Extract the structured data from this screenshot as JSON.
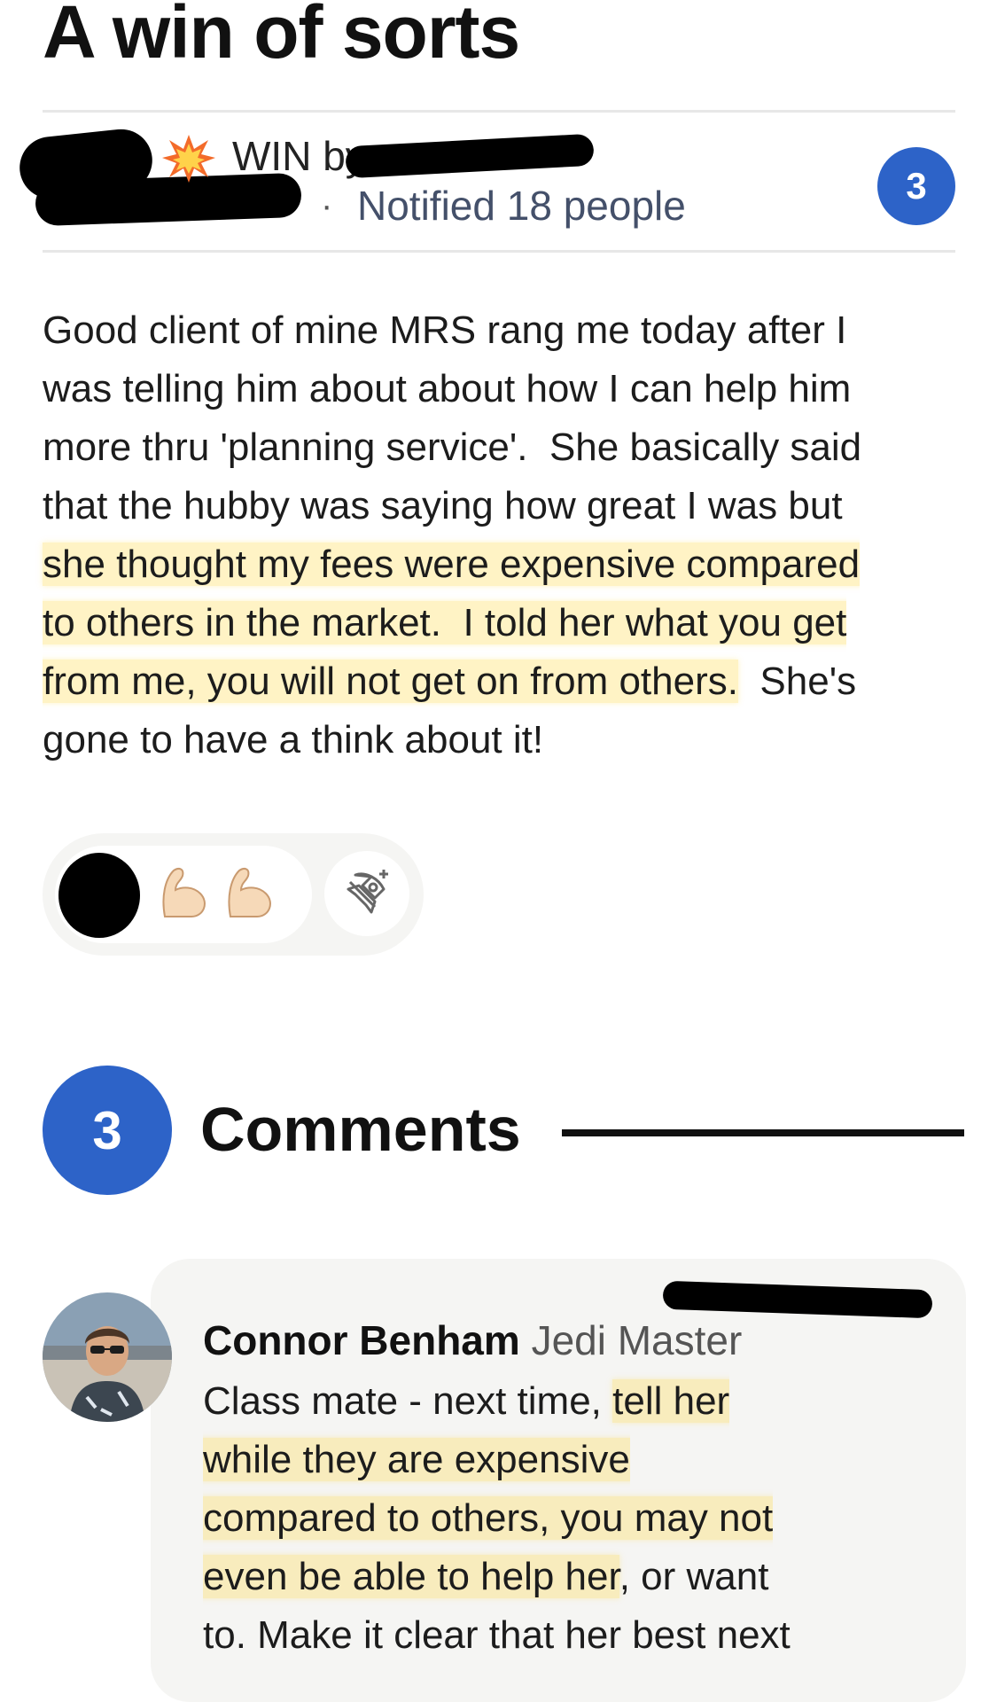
{
  "post": {
    "title": "A win of sorts",
    "win_label": "WIN by",
    "notified": "Notified 18 people",
    "comment_count": "3",
    "body": [
      {
        "text": "Good client of mine MRS rang me today after I\nwas telling him about about how I can help him\nmore thru 'planning service'.  She basically said\nthat the hubby was saying how great I was but\n",
        "highlight": false
      },
      {
        "text": "she thought my fees were expensive compared\nto others in the market.  I told her what you get\nfrom me, you will not get on from others.",
        "highlight": true
      },
      {
        "text": "  She's\ngone to have a think about it!",
        "highlight": false
      }
    ],
    "icons": {
      "win": "collision-icon",
      "reaction": "flexed-biceps-icon",
      "add_reaction": "rocket-add-reaction-icon"
    }
  },
  "comments_section": {
    "count": "3",
    "title": "Comments"
  },
  "comment": {
    "author": "Connor Benham",
    "rank": "Jedi Master",
    "body_parts": [
      {
        "text": "Class mate - next time, ",
        "highlight": false
      },
      {
        "text": "tell her\nwhile they are expensive\ncompared to others, you may not\neven be able to help her",
        "highlight": true
      },
      {
        "text": ", or want\nto. Make it clear that her best next",
        "highlight": false
      }
    ]
  },
  "colors": {
    "accent_blue": "#2d63c8",
    "highlight_yellow": "#ffdc5a",
    "card_bg": "#f5f5f3"
  }
}
